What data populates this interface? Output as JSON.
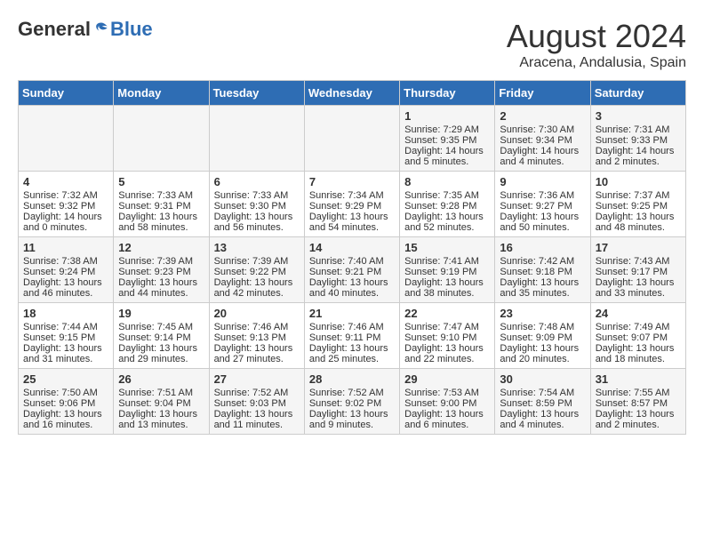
{
  "logo": {
    "general": "General",
    "blue": "Blue"
  },
  "title": "August 2024",
  "location": "Aracena, Andalusia, Spain",
  "days_of_week": [
    "Sunday",
    "Monday",
    "Tuesday",
    "Wednesday",
    "Thursday",
    "Friday",
    "Saturday"
  ],
  "weeks": [
    [
      {
        "day": "",
        "content": ""
      },
      {
        "day": "",
        "content": ""
      },
      {
        "day": "",
        "content": ""
      },
      {
        "day": "",
        "content": ""
      },
      {
        "day": "1",
        "content": "Sunrise: 7:29 AM\nSunset: 9:35 PM\nDaylight: 14 hours and 5 minutes."
      },
      {
        "day": "2",
        "content": "Sunrise: 7:30 AM\nSunset: 9:34 PM\nDaylight: 14 hours and 4 minutes."
      },
      {
        "day": "3",
        "content": "Sunrise: 7:31 AM\nSunset: 9:33 PM\nDaylight: 14 hours and 2 minutes."
      }
    ],
    [
      {
        "day": "4",
        "content": "Sunrise: 7:32 AM\nSunset: 9:32 PM\nDaylight: 14 hours and 0 minutes."
      },
      {
        "day": "5",
        "content": "Sunrise: 7:33 AM\nSunset: 9:31 PM\nDaylight: 13 hours and 58 minutes."
      },
      {
        "day": "6",
        "content": "Sunrise: 7:33 AM\nSunset: 9:30 PM\nDaylight: 13 hours and 56 minutes."
      },
      {
        "day": "7",
        "content": "Sunrise: 7:34 AM\nSunset: 9:29 PM\nDaylight: 13 hours and 54 minutes."
      },
      {
        "day": "8",
        "content": "Sunrise: 7:35 AM\nSunset: 9:28 PM\nDaylight: 13 hours and 52 minutes."
      },
      {
        "day": "9",
        "content": "Sunrise: 7:36 AM\nSunset: 9:27 PM\nDaylight: 13 hours and 50 minutes."
      },
      {
        "day": "10",
        "content": "Sunrise: 7:37 AM\nSunset: 9:25 PM\nDaylight: 13 hours and 48 minutes."
      }
    ],
    [
      {
        "day": "11",
        "content": "Sunrise: 7:38 AM\nSunset: 9:24 PM\nDaylight: 13 hours and 46 minutes."
      },
      {
        "day": "12",
        "content": "Sunrise: 7:39 AM\nSunset: 9:23 PM\nDaylight: 13 hours and 44 minutes."
      },
      {
        "day": "13",
        "content": "Sunrise: 7:39 AM\nSunset: 9:22 PM\nDaylight: 13 hours and 42 minutes."
      },
      {
        "day": "14",
        "content": "Sunrise: 7:40 AM\nSunset: 9:21 PM\nDaylight: 13 hours and 40 minutes."
      },
      {
        "day": "15",
        "content": "Sunrise: 7:41 AM\nSunset: 9:19 PM\nDaylight: 13 hours and 38 minutes."
      },
      {
        "day": "16",
        "content": "Sunrise: 7:42 AM\nSunset: 9:18 PM\nDaylight: 13 hours and 35 minutes."
      },
      {
        "day": "17",
        "content": "Sunrise: 7:43 AM\nSunset: 9:17 PM\nDaylight: 13 hours and 33 minutes."
      }
    ],
    [
      {
        "day": "18",
        "content": "Sunrise: 7:44 AM\nSunset: 9:15 PM\nDaylight: 13 hours and 31 minutes."
      },
      {
        "day": "19",
        "content": "Sunrise: 7:45 AM\nSunset: 9:14 PM\nDaylight: 13 hours and 29 minutes."
      },
      {
        "day": "20",
        "content": "Sunrise: 7:46 AM\nSunset: 9:13 PM\nDaylight: 13 hours and 27 minutes."
      },
      {
        "day": "21",
        "content": "Sunrise: 7:46 AM\nSunset: 9:11 PM\nDaylight: 13 hours and 25 minutes."
      },
      {
        "day": "22",
        "content": "Sunrise: 7:47 AM\nSunset: 9:10 PM\nDaylight: 13 hours and 22 minutes."
      },
      {
        "day": "23",
        "content": "Sunrise: 7:48 AM\nSunset: 9:09 PM\nDaylight: 13 hours and 20 minutes."
      },
      {
        "day": "24",
        "content": "Sunrise: 7:49 AM\nSunset: 9:07 PM\nDaylight: 13 hours and 18 minutes."
      }
    ],
    [
      {
        "day": "25",
        "content": "Sunrise: 7:50 AM\nSunset: 9:06 PM\nDaylight: 13 hours and 16 minutes."
      },
      {
        "day": "26",
        "content": "Sunrise: 7:51 AM\nSunset: 9:04 PM\nDaylight: 13 hours and 13 minutes."
      },
      {
        "day": "27",
        "content": "Sunrise: 7:52 AM\nSunset: 9:03 PM\nDaylight: 13 hours and 11 minutes."
      },
      {
        "day": "28",
        "content": "Sunrise: 7:52 AM\nSunset: 9:02 PM\nDaylight: 13 hours and 9 minutes."
      },
      {
        "day": "29",
        "content": "Sunrise: 7:53 AM\nSunset: 9:00 PM\nDaylight: 13 hours and 6 minutes."
      },
      {
        "day": "30",
        "content": "Sunrise: 7:54 AM\nSunset: 8:59 PM\nDaylight: 13 hours and 4 minutes."
      },
      {
        "day": "31",
        "content": "Sunrise: 7:55 AM\nSunset: 8:57 PM\nDaylight: 13 hours and 2 minutes."
      }
    ]
  ]
}
